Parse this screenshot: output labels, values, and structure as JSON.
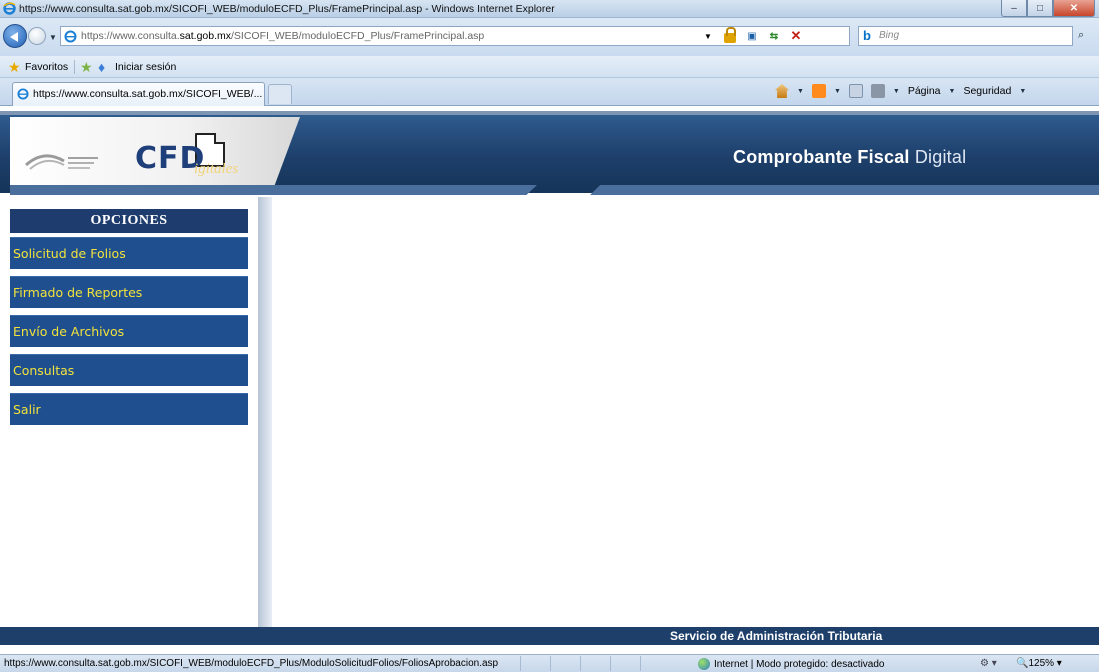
{
  "window": {
    "title": "https://www.consulta.sat.gob.mx/SICOFI_WEB/moduloECFD_Plus/FramePrincipal.asp - Windows Internet Explorer",
    "min_glyph": "–",
    "max_glyph": "□",
    "close_glyph": "✕"
  },
  "address": {
    "url_prefix": "https://www.consulta.",
    "url_domain": "sat.gob.mx",
    "url_suffix": "/SICOFI_WEB/moduloECFD_Plus/FramePrincipal.asp",
    "search_placeholder": "Bing"
  },
  "favorites": {
    "label": "Favoritos",
    "login": "Iniciar sesión"
  },
  "tab": {
    "label": "https://www.consulta.sat.gob.mx/SICOFI_WEB/..."
  },
  "commandbar": {
    "page": "Página",
    "security": "Seguridad"
  },
  "banner": {
    "cfd": "CFD",
    "cfd_small": "igitales",
    "title_main": "Comprobante Fiscal ",
    "title_digital": "Digital"
  },
  "sidebar": {
    "header": "OPCIONES",
    "items": [
      {
        "label": "Solicitud de Folios"
      },
      {
        "label": "Firmado de Reportes"
      },
      {
        "label": "Envío de Archivos"
      },
      {
        "label": "Consultas"
      },
      {
        "label": "Salir"
      }
    ]
  },
  "footer": {
    "text": "Servicio de Administración Tributaria"
  },
  "status": {
    "url": "https://www.consulta.sat.gob.mx/SICOFI_WEB/moduloECFD_Plus/ModuloSolicitudFolios/FoliosAprobacion.asp",
    "zone": "Internet | Modo protegido: desactivado",
    "zoom": "125%"
  },
  "colors": {
    "banner_blue": "#1d3f6a",
    "menu_blue": "#1f4f8f",
    "menu_text": "#f2e33b"
  }
}
